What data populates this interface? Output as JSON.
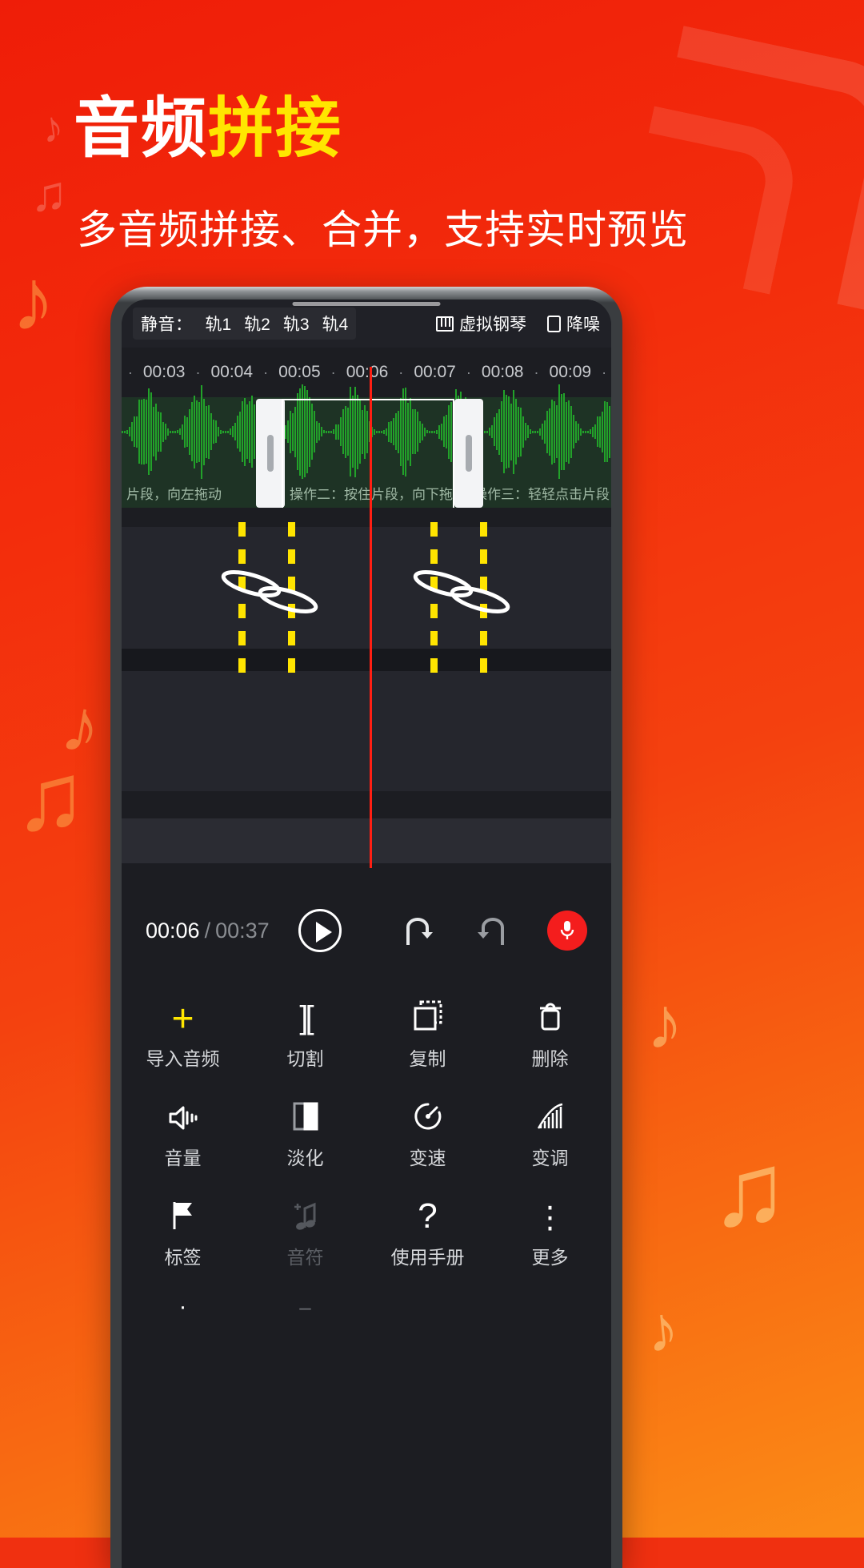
{
  "promo": {
    "title_white": "音频",
    "title_yellow": "拼接",
    "subtitle": "多音频拼接、合并，支持实时预览",
    "colors": {
      "bg_start": "#ef1d08",
      "bg_end": "#fb8c16",
      "accent_yellow": "#ffe600"
    }
  },
  "app": {
    "toolbar": {
      "mute_label": "静音：",
      "tracks": [
        "轨1",
        "轨2",
        "轨3",
        "轨4"
      ],
      "virtual_piano": "虚拟钢琴",
      "noise_reduction": "降噪"
    },
    "ruler": {
      "labels": [
        "00:03",
        "00:04",
        "00:05",
        "00:06",
        "00:07",
        "00:08",
        "00:09"
      ],
      "tick_glyph": "·"
    },
    "track": {
      "hint_left": "片段，向左拖动",
      "hint_mid": "操作二：按住片段，向下拖动，",
      "hint_right": "操作三：轻轻点击片段，拖动",
      "waveform_color": "#22a22a",
      "clip_bg": "#1e3325"
    },
    "transport": {
      "current_time": "00:06",
      "separator": "/",
      "total_time": "00:37",
      "play_label": "播放",
      "undo_label": "撤销",
      "redo_label": "重做",
      "record_label": "录音"
    },
    "tools": [
      [
        {
          "label": "导入音频",
          "icon": "plus-icon",
          "glyph": "+",
          "dim": false
        },
        {
          "label": "切割",
          "icon": "split-icon",
          "glyph": "][",
          "dim": false
        },
        {
          "label": "复制",
          "icon": "copy-icon",
          "glyph": "",
          "dim": false
        },
        {
          "label": "删除",
          "icon": "trash-icon",
          "glyph": "",
          "dim": false
        }
      ],
      [
        {
          "label": "音量",
          "icon": "volume-icon",
          "glyph": "",
          "dim": false
        },
        {
          "label": "淡化",
          "icon": "fade-icon",
          "glyph": "",
          "dim": false
        },
        {
          "label": "变速",
          "icon": "speedometer-icon",
          "glyph": "",
          "dim": false
        },
        {
          "label": "变调",
          "icon": "pitch-bars-icon",
          "glyph": "",
          "dim": false
        }
      ],
      [
        {
          "label": "标签",
          "icon": "flag-icon",
          "glyph": "",
          "dim": false
        },
        {
          "label": "音符",
          "icon": "music-note-icon",
          "glyph": "",
          "dim": true
        },
        {
          "label": "使用手册",
          "icon": "help-icon",
          "glyph": "?",
          "dim": false
        },
        {
          "label": "更多",
          "icon": "more-icon",
          "glyph": "⋮",
          "dim": false
        }
      ]
    ]
  }
}
